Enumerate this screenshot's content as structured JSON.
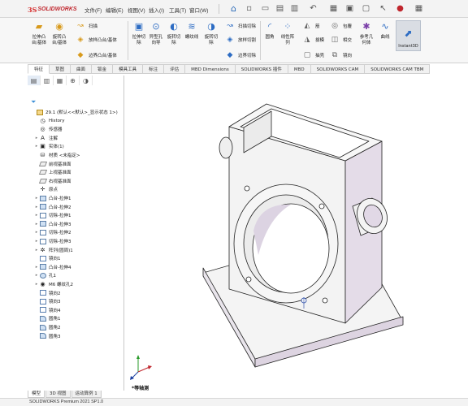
{
  "app": {
    "logo_ds": "3S",
    "logo_name": "SOLIDWORKS"
  },
  "menu": [
    {
      "label": "文件(F)"
    },
    {
      "label": "编辑(E)"
    },
    {
      "label": "视图(V)"
    },
    {
      "label": "插入(I)"
    },
    {
      "label": "工具(T)"
    },
    {
      "label": "窗口(W)"
    }
  ],
  "ribbon": {
    "left_tools": [
      {
        "label": "拉伸凸\n台/基体",
        "icon": "extruded-boss-icon"
      },
      {
        "label": "旋转凸\n台/基体",
        "icon": "revolved-boss-icon"
      }
    ],
    "sweep_group": [
      {
        "label": "扫描",
        "icon": "swept-boss-icon"
      },
      {
        "label": "放样凸台/基体",
        "icon": "lofted-boss-icon"
      },
      {
        "label": "边界凸台/基体",
        "icon": "boundary-boss-icon"
      }
    ],
    "cut_tools": [
      {
        "label": "拉伸切\n除",
        "icon": "extruded-cut-icon"
      },
      {
        "label": "异型孔\n向导",
        "icon": "hole-wizard-icon"
      },
      {
        "label": "旋转切\n除",
        "icon": "revolved-cut-icon"
      },
      {
        "label": "螺纹线",
        "icon": "thread-icon"
      },
      {
        "label": "旋转切\n除",
        "icon": "revolved-cut-2-icon"
      }
    ],
    "cut_group": [
      {
        "label": "扫描切除",
        "icon": "swept-cut-icon"
      },
      {
        "label": "放样切割",
        "icon": "lofted-cut-icon"
      },
      {
        "label": "边界切除",
        "icon": "boundary-cut-icon"
      }
    ],
    "feature_tools": [
      {
        "label": "圆角",
        "icon": "fillet-icon"
      },
      {
        "label": "线性阵\n列",
        "icon": "linear-pattern-icon"
      }
    ],
    "misc_group": [
      {
        "label": "筋",
        "icon": "rib-icon"
      },
      {
        "label": "拔模",
        "icon": "draft-icon"
      },
      {
        "label": "抽壳",
        "icon": "shell-icon"
      },
      {
        "label": "包覆",
        "icon": "wrap-icon"
      },
      {
        "label": "相交",
        "icon": "intersect-icon"
      },
      {
        "label": "镜向",
        "icon": "mirror-icon"
      }
    ],
    "ref_tools": [
      {
        "label": "参考几\n何体",
        "icon": "reference-geometry-icon"
      },
      {
        "label": "曲线",
        "icon": "curves-icon"
      }
    ],
    "instant3d": "Instant3D"
  },
  "tabs": [
    "特征",
    "草图",
    "曲面",
    "钣金",
    "模具工具",
    "标注",
    "评估",
    "MBD Dimensions",
    "SOLIDWORKS 插件",
    "MBD",
    "SOLIDWORKS CAM",
    "SOLIDWORKS CAM TBM"
  ],
  "feature_tree": [
    {
      "label": "29.1  (默认<<默认>_显示状态 1>)",
      "icon": "part-icon",
      "arrow": ""
    },
    {
      "label": "History",
      "icon": "history-icon",
      "arrow": ""
    },
    {
      "label": "传感器",
      "icon": "sensors-icon",
      "arrow": ""
    },
    {
      "label": "注解",
      "icon": "annotations-icon",
      "arrow": "▸"
    },
    {
      "label": "实体(1)",
      "icon": "solid-bodies-icon",
      "arrow": "▸"
    },
    {
      "label": "材质 <未指定>",
      "icon": "material-icon",
      "arrow": ""
    },
    {
      "label": "前视基准面",
      "icon": "plane-icon",
      "arrow": ""
    },
    {
      "label": "上视基准面",
      "icon": "plane-icon",
      "arrow": ""
    },
    {
      "label": "右视基准面",
      "icon": "plane-icon",
      "arrow": ""
    },
    {
      "label": "原点",
      "icon": "origin-icon",
      "arrow": ""
    },
    {
      "label": "凸台-拉伸1",
      "icon": "extrude-icon",
      "arrow": "▸"
    },
    {
      "label": "凸台-拉伸2",
      "icon": "extrude-icon",
      "arrow": "▸"
    },
    {
      "label": "切除-拉伸1",
      "icon": "cut-extrude-icon",
      "arrow": "▸"
    },
    {
      "label": "凸台-拉伸3",
      "icon": "extrude-icon",
      "arrow": "▸"
    },
    {
      "label": "切除-拉伸2",
      "icon": "cut-extrude-icon",
      "arrow": "▸"
    },
    {
      "label": "切除-拉伸3",
      "icon": "cut-extrude-icon",
      "arrow": "▸"
    },
    {
      "label": "阵列(圆周)1",
      "icon": "circular-pattern-icon",
      "arrow": "▸"
    },
    {
      "label": "镜向1",
      "icon": "mirror-feature-icon",
      "arrow": ""
    },
    {
      "label": "凸台-拉伸4",
      "icon": "extrude-icon",
      "arrow": "▸"
    },
    {
      "label": "孔1",
      "icon": "hole-icon",
      "arrow": "▸"
    },
    {
      "label": "M6 螺纹孔2",
      "icon": "tapped-hole-icon",
      "arrow": "▸"
    },
    {
      "label": "镜向2",
      "icon": "mirror-feature-icon",
      "arrow": ""
    },
    {
      "label": "镜向3",
      "icon": "mirror-feature-icon",
      "arrow": ""
    },
    {
      "label": "镜向4",
      "icon": "mirror-feature-icon",
      "arrow": ""
    },
    {
      "label": "圆角1",
      "icon": "fillet-feature-icon",
      "arrow": ""
    },
    {
      "label": "圆角2",
      "icon": "fillet-feature-icon",
      "arrow": ""
    },
    {
      "label": "圆角3",
      "icon": "fillet-feature-icon",
      "arrow": ""
    }
  ],
  "bottom_tabs": [
    "模型",
    "3D 视图",
    "运动算例 1"
  ],
  "status": "SOLIDWORKS Premium 2021 SP1.0",
  "view_label": "*等轴测",
  "colors": {
    "model_face": "#f2f2f2",
    "model_side": "#e3dbe6",
    "model_edge": "#222222",
    "brand_red": "#d62828"
  }
}
